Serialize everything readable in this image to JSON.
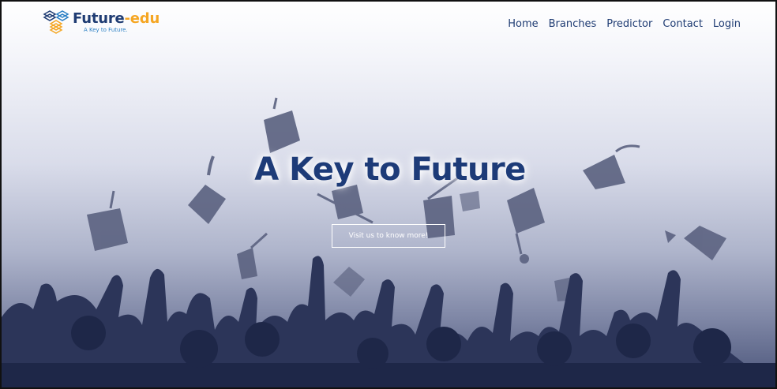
{
  "brand": {
    "name_main": "Future",
    "name_accent": "-edu",
    "tagline": "A Key to Future.",
    "logo_icon": "stacked-books-icon",
    "colors": {
      "primary": "#1f3c73",
      "accent": "#f5a623",
      "tagline": "#2a7fc4"
    }
  },
  "nav": {
    "items": [
      {
        "label": "Home"
      },
      {
        "label": "Branches"
      },
      {
        "label": "Predictor"
      },
      {
        "label": "Contact"
      },
      {
        "label": "Login"
      }
    ]
  },
  "hero": {
    "title": "A Key to Future",
    "button_label": "Visit us to know more!",
    "background_image": "graduates-throwing-caps-silhouette"
  }
}
